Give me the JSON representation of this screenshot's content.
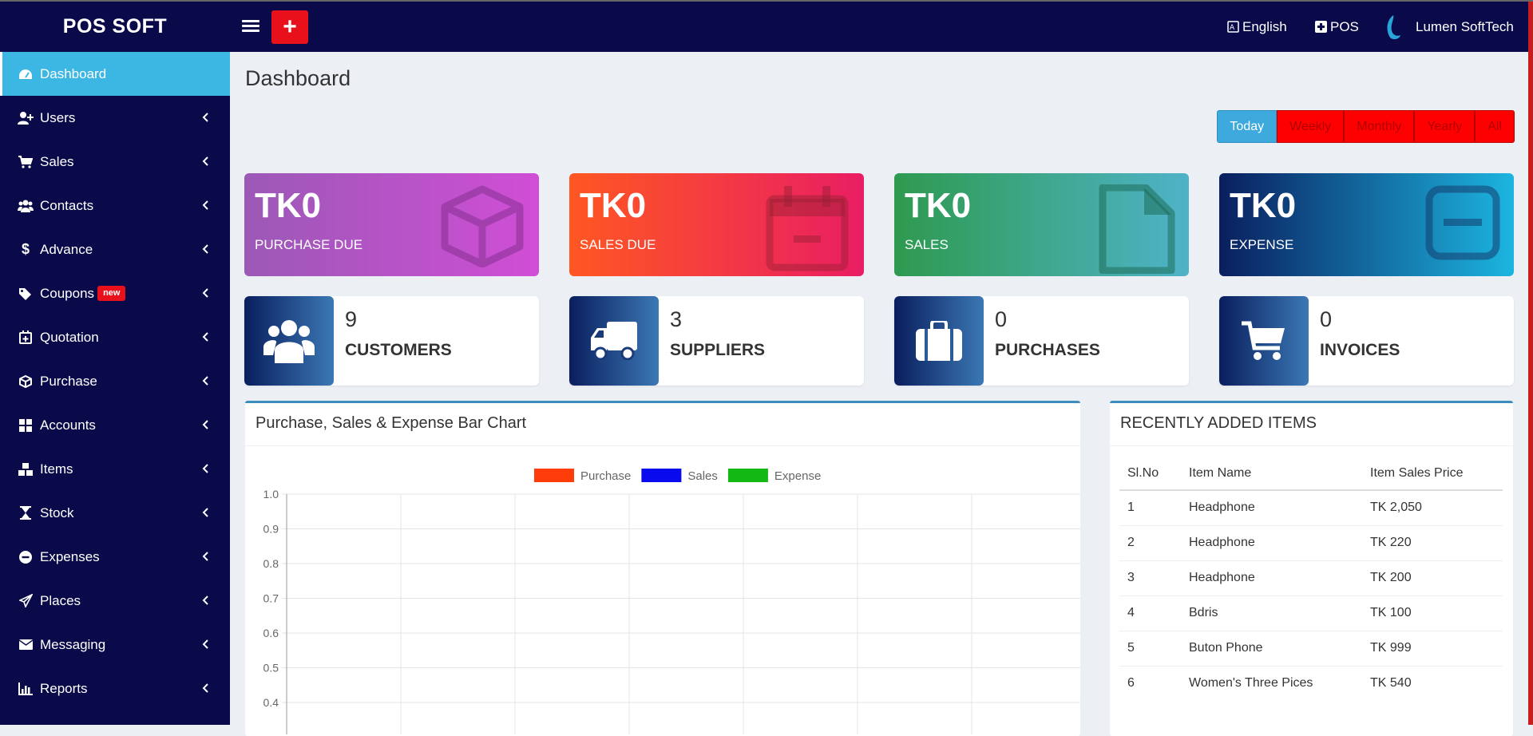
{
  "header": {
    "brand": "POS SOFT",
    "add_label": "+",
    "language": "English",
    "pos": "POS",
    "user": "Lumen SoftTech"
  },
  "sidebar": {
    "items": [
      {
        "label": "Dashboard",
        "icon": "dashboard-icon",
        "active": true
      },
      {
        "label": "Users",
        "icon": "user-plus-icon"
      },
      {
        "label": "Sales",
        "icon": "cart-icon"
      },
      {
        "label": "Contacts",
        "icon": "users-icon"
      },
      {
        "label": "Advance",
        "icon": "dollar-icon"
      },
      {
        "label": "Coupons",
        "icon": "tags-icon",
        "badge": "new"
      },
      {
        "label": "Quotation",
        "icon": "calendar-plus-icon"
      },
      {
        "label": "Purchase",
        "icon": "cube-icon"
      },
      {
        "label": "Accounts",
        "icon": "grid-icon"
      },
      {
        "label": "Items",
        "icon": "cubes-icon"
      },
      {
        "label": "Stock",
        "icon": "hourglass-icon"
      },
      {
        "label": "Expenses",
        "icon": "minus-circle-icon"
      },
      {
        "label": "Places",
        "icon": "paper-plane-icon"
      },
      {
        "label": "Messaging",
        "icon": "envelope-icon"
      },
      {
        "label": "Reports",
        "icon": "bar-chart-icon"
      }
    ]
  },
  "page": {
    "title": "Dashboard"
  },
  "filters": [
    "Today",
    "Weekly",
    "Monthly",
    "Yearly",
    "All"
  ],
  "stat_cards": [
    {
      "value": "TK0",
      "label": "PURCHASE DUE",
      "icon": "cube-icon",
      "gradient": [
        "#9b59b6",
        "#d04ed6"
      ]
    },
    {
      "value": "TK0",
      "label": "SALES DUE",
      "icon": "calendar-icon",
      "gradient": [
        "#ff5722",
        "#e91e63"
      ]
    },
    {
      "value": "TK0",
      "label": "SALES",
      "icon": "file-icon",
      "gradient": [
        "#2e9a4f",
        "#4fb3c9"
      ]
    },
    {
      "value": "TK0",
      "label": "EXPENSE",
      "icon": "minus-square-icon",
      "gradient": [
        "#0a1e5e",
        "#1cb5e0"
      ]
    }
  ],
  "info_boxes": [
    {
      "value": "9",
      "label": "CUSTOMERS",
      "icon": "users-icon"
    },
    {
      "value": "3",
      "label": "SUPPLIERS",
      "icon": "truck-icon"
    },
    {
      "value": "0",
      "label": "PURCHASES",
      "icon": "briefcase-icon"
    },
    {
      "value": "0",
      "label": "INVOICES",
      "icon": "cart-icon"
    }
  ],
  "chart_panel": {
    "title": "Purchase, Sales & Expense Bar Chart"
  },
  "chart_data": {
    "type": "bar",
    "categories": [],
    "series": [
      {
        "name": "Purchase",
        "values": [],
        "color": "#ff3d0a"
      },
      {
        "name": "Sales",
        "values": [],
        "color": "#0a0aee"
      },
      {
        "name": "Expense",
        "values": [],
        "color": "#14b814"
      }
    ],
    "y_ticks": [
      "1.0",
      "0.9",
      "0.8",
      "0.7",
      "0.6",
      "0.5",
      "0.4"
    ],
    "ylim": [
      0,
      1.0
    ],
    "grid": true,
    "legend": "top-center"
  },
  "items_panel": {
    "title": "RECENTLY ADDED ITEMS",
    "columns": [
      "Sl.No",
      "Item Name",
      "Item Sales Price"
    ],
    "rows": [
      [
        "1",
        "Headphone",
        "TK 2,050"
      ],
      [
        "2",
        "Headphone",
        "TK 220"
      ],
      [
        "3",
        "Headphone",
        "TK 200"
      ],
      [
        "4",
        "Bdris",
        "TK 100"
      ],
      [
        "5",
        "Buton Phone",
        "TK 999"
      ],
      [
        "6",
        "Women's Three Pices",
        "TK 540"
      ]
    ]
  }
}
